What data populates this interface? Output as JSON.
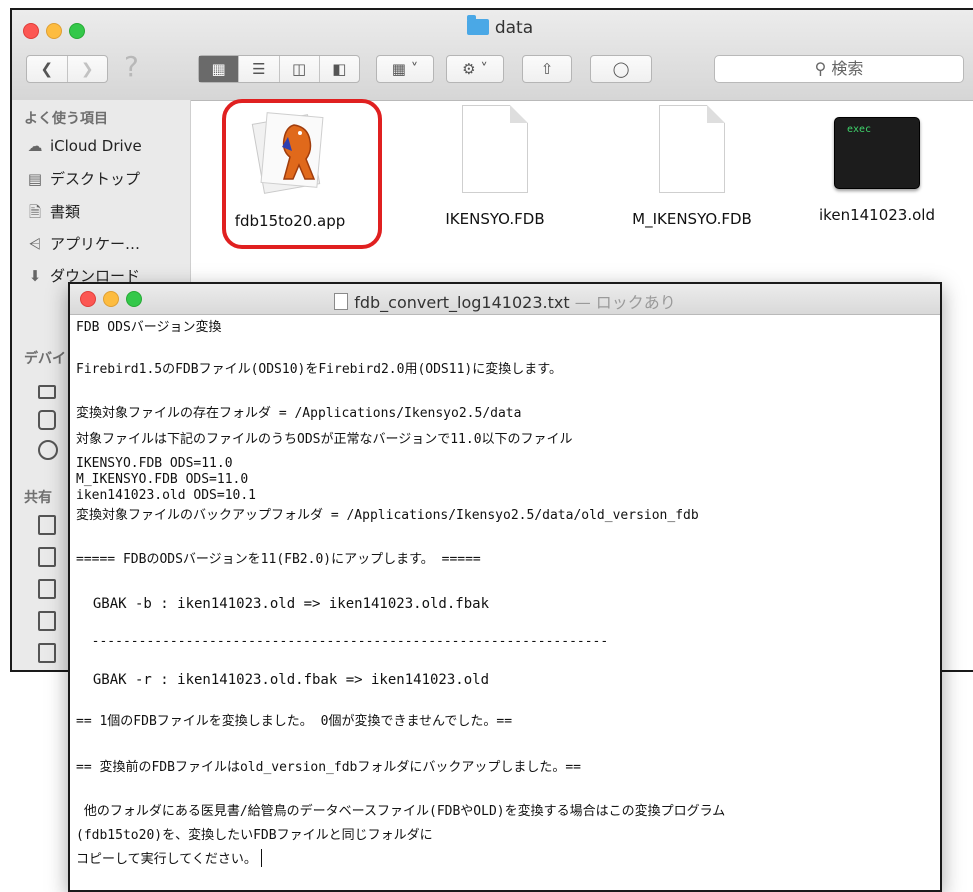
{
  "finder": {
    "title": "data",
    "search_placeholder": "検索",
    "help_glyph": "?",
    "sidebar": {
      "favorites_heading": "よく使う項目",
      "items": [
        {
          "label": "iCloud Drive",
          "icon": "cloud-icon"
        },
        {
          "label": "デスクトップ",
          "icon": "desktop-icon"
        },
        {
          "label": "書類",
          "icon": "documents-icon"
        },
        {
          "label": "アプリケー…",
          "icon": "applications-icon"
        },
        {
          "label": "ダウンロード",
          "icon": "downloads-icon"
        }
      ],
      "devices_heading": "デバイ",
      "shared_heading": "共有"
    },
    "files": [
      {
        "name": "fdb15to20.app",
        "selected": true
      },
      {
        "name": "IKENSYO.FDB"
      },
      {
        "name": "M_IKENSYO.FDB"
      },
      {
        "name": "iken141023.old",
        "icon_text": "exec"
      }
    ]
  },
  "editor": {
    "filename": "fdb_convert_log141023.txt",
    "title_suffix": "— ロックあり",
    "lines": [
      "FDB ODSバージョン変換",
      "Firebird1.5のFDBファイル(ODS10)をFirebird2.0用(ODS11)に変換します。",
      "変換対象ファイルの存在フォルダ = /Applications/Ikensyo2.5/data",
      "対象ファイルは下記のファイルのうちODSが正常なバージョンで11.0以下のファイル",
      "IKENSYO.FDB ODS=11.0",
      "M_IKENSYO.FDB ODS=11.0",
      "iken141023.old ODS=10.1",
      "変換対象ファイルのバックアップフォルダ = /Applications/Ikensyo2.5/data/old_version_fdb",
      "===== FDBのODSバージョンを11(FB2.0)にアップします。 =====",
      "  GBAK -b : iken141023.old => iken141023.old.fbak",
      "  ------------------------------------------------------------------",
      "  GBAK -r : iken141023.old.fbak => iken141023.old",
      "== 1個のFDBファイルを変換しました。 0個が変換できませんでした。==",
      "== 変換前のFDBファイルはold_version_fdbフォルダにバックアップしました。==",
      " 他のフォルダにある医見書/給管鳥のデータベースファイル(FDBやOLD)を変換する場合はこの変換プログラム",
      "(fdb15to20)を、変換したいFDBファイルと同じフォルダに",
      "コピーして実行してください。"
    ]
  },
  "colors": {
    "selection_ring": "#e02020",
    "close": "#fc5753",
    "minimize": "#fdbc40",
    "zoom": "#34c84a",
    "folder": "#4aa8e6"
  }
}
